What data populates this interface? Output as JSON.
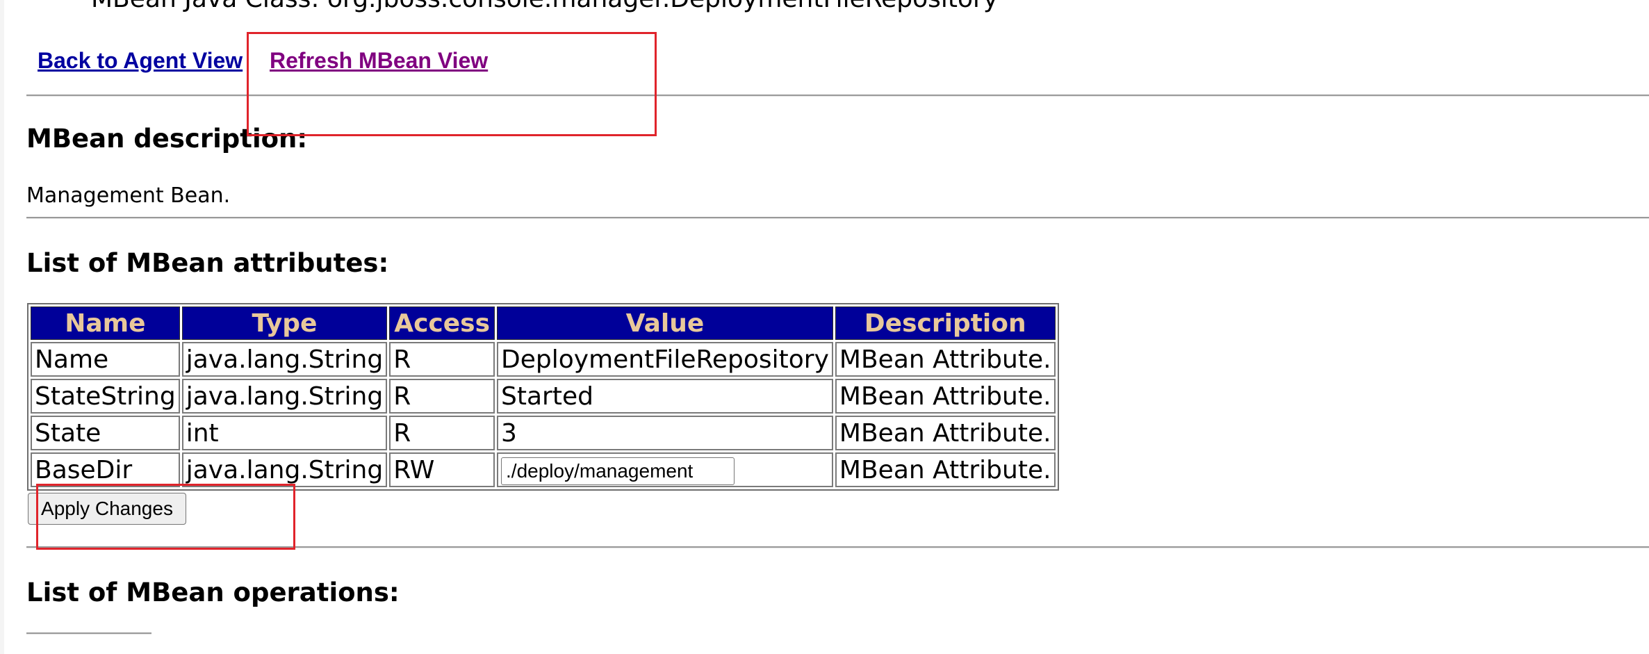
{
  "header": {
    "java_class_line": "MBean Java Class: org.jboss.console.manager.DeploymentFileRepository"
  },
  "nav": {
    "back_label": "Back to Agent View",
    "refresh_label": "Refresh MBean View"
  },
  "description": {
    "heading": "MBean description:",
    "text": "Management Bean."
  },
  "attributes": {
    "heading": "List of MBean attributes:",
    "columns": [
      "Name",
      "Type",
      "Access",
      "Value",
      "Description"
    ],
    "rows": [
      {
        "name": "Name",
        "type": "java.lang.String",
        "access": "R",
        "value": "DeploymentFileRepository",
        "description": "MBean Attribute."
      },
      {
        "name": "StateString",
        "type": "java.lang.String",
        "access": "R",
        "value": "Started",
        "description": "MBean Attribute."
      },
      {
        "name": "State",
        "type": "int",
        "access": "R",
        "value": "3",
        "description": "MBean Attribute."
      },
      {
        "name": "BaseDir",
        "type": "java.lang.String",
        "access": "RW",
        "value": "./deploy/management",
        "description": "MBean Attribute."
      }
    ],
    "apply_label": "Apply Changes"
  },
  "operations": {
    "heading": "List of MBean operations:"
  },
  "colors": {
    "header_bg": "#000099",
    "header_text": "#e8c89a",
    "link": "#0000a0",
    "visited_link": "#800080",
    "annotation": "#e0242b"
  }
}
